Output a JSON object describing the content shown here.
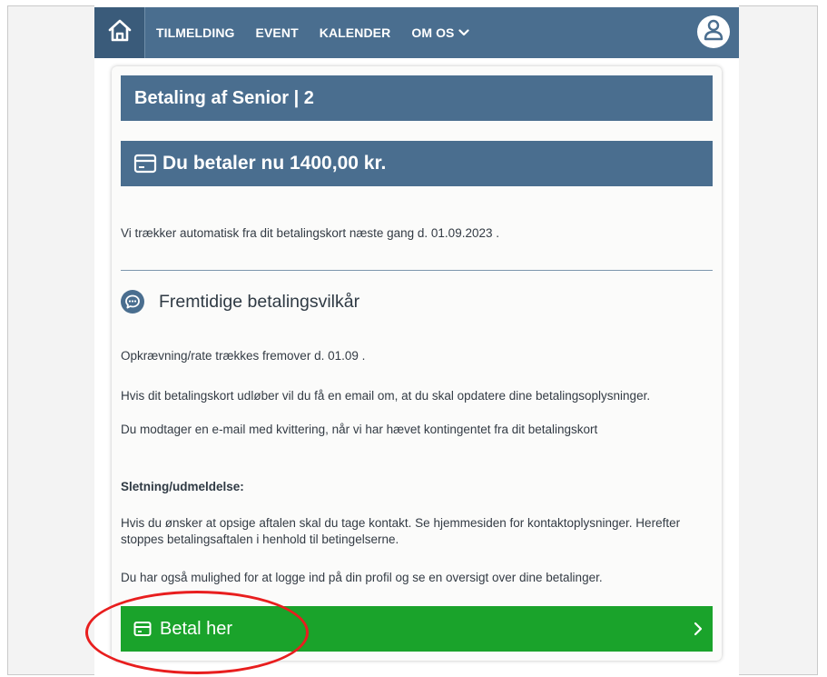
{
  "nav": {
    "items": [
      "TILMELDING",
      "EVENT",
      "KALENDER",
      "OM OS"
    ],
    "brand_color": "#4a6e8f"
  },
  "card": {
    "title": "Betaling af Senior | 2",
    "amount": "Du betaler nu 1400,00 kr.",
    "auto_charge": "Vi trækker automatisk fra dit betalingskort næste gang d. 01.09.2023 .",
    "section_title": "Fremtidige betalingsvilkår",
    "p1": "Opkrævning/rate trækkes fremover d. 01.09 .",
    "p2": "Hvis dit betalingskort udløber vil du få en email om, at du skal opdatere dine betalingsoplysninger.",
    "p3": "Du modtager en e-mail med kvittering, når vi har hævet kontingentet fra dit betalingskort",
    "cancel_heading": "Sletning/udmeldelse:",
    "p4": "Hvis du ønsker at opsige aftalen skal du tage kontakt. Se hjemmesiden for kontaktoplysninger. Herefter stoppes betalingsaftalen i henhold til betingelserne.",
    "p5": "Du har også mulighed for at logge ind på din profil og se en oversigt over dine betalinger.",
    "pay_button": "Betal her",
    "pay_color": "#1aa32b"
  },
  "icons": [
    "home-icon",
    "chevron-down-icon",
    "user-icon",
    "credit-card-icon",
    "chat-icon",
    "chevron-right-icon"
  ],
  "annotation_color": "#e81e1e"
}
